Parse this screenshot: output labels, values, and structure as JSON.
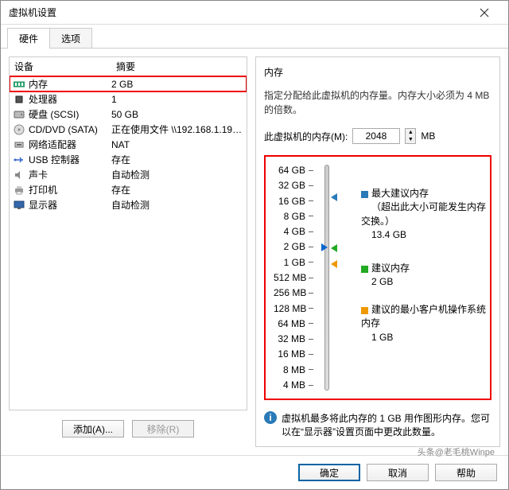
{
  "window": {
    "title": "虚拟机设置"
  },
  "tabs": {
    "hardware": "硬件",
    "options": "选项"
  },
  "columns": {
    "device": "设备",
    "summary": "摘要"
  },
  "devices": [
    {
      "icon": "memory-icon",
      "name": "内存",
      "summary": "2 GB",
      "hl": true
    },
    {
      "icon": "cpu-icon",
      "name": "处理器",
      "summary": "1"
    },
    {
      "icon": "hdd-icon",
      "name": "硬盘 (SCSI)",
      "summary": "50 GB"
    },
    {
      "icon": "cd-icon",
      "name": "CD/DVD (SATA)",
      "summary": "正在使用文件 \\\\192.168.1.198..."
    },
    {
      "icon": "net-icon",
      "name": "网络适配器",
      "summary": "NAT"
    },
    {
      "icon": "usb-icon",
      "name": "USB 控制器",
      "summary": "存在"
    },
    {
      "icon": "sound-icon",
      "name": "声卡",
      "summary": "自动检测"
    },
    {
      "icon": "printer-icon",
      "name": "打印机",
      "summary": "存在"
    },
    {
      "icon": "display-icon",
      "name": "显示器",
      "summary": "自动检测"
    }
  ],
  "left_buttons": {
    "add": "添加(A)...",
    "remove": "移除(R)"
  },
  "mem": {
    "heading": "内存",
    "desc": "指定分配给此虚拟机的内存量。内存大小必须为 4 MB 的倍数。",
    "label": "此虚拟机的内存(M):",
    "value": "2048",
    "unit": "MB",
    "ticks": [
      "64 GB",
      "32 GB",
      "16 GB",
      "8 GB",
      "4 GB",
      "2 GB",
      "1 GB",
      "512 MB",
      "256 MB",
      "128 MB",
      "64 MB",
      "32 MB",
      "16 MB",
      "8 MB",
      "4 MB"
    ],
    "leg_max_title": "最大建议内存",
    "leg_max_note": "（超出此大小可能发生内存交换。）",
    "leg_max_val": "13.4 GB",
    "leg_rec_title": "建议内存",
    "leg_rec_val": "2 GB",
    "leg_min_title": "建议的最小客户机操作系统内存",
    "leg_min_val": "1 GB",
    "info": "虚拟机最多将此内存的 1 GB 用作图形内存。您可以在“显示器”设置页面中更改此数量。"
  },
  "dlg": {
    "ok": "确定",
    "cancel": "取消",
    "help": "帮助"
  },
  "watermark": "头条@老毛桃Winpe"
}
